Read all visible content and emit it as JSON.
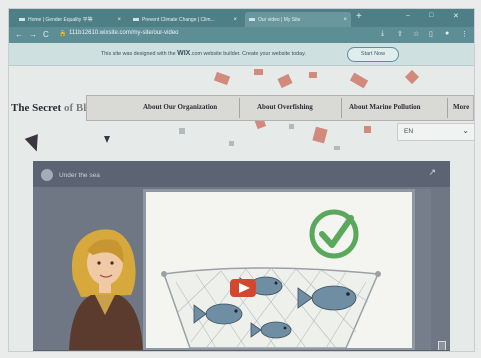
{
  "browser": {
    "tabs": [
      {
        "label": "Home | Gender Equality 平等",
        "active": false
      },
      {
        "label": "Prevent Climate Change | Clim...",
        "active": false
      },
      {
        "label": "Our video | My Site",
        "active": true
      }
    ],
    "new_tab_symbol": "+",
    "window_controls": {
      "minimize": "–",
      "maximize": "□",
      "close": "✕"
    },
    "nav": {
      "back": "←",
      "forward": "→",
      "reload": "C"
    },
    "url": "111b12610.wixsite.com/my-site/our-video",
    "address_icons": [
      "download-icon",
      "share-icon",
      "star-icon",
      "sidebar-icon",
      "profile-icon",
      "kebab-icon"
    ]
  },
  "wix_banner": {
    "text_prefix": "This site was designed with the ",
    "brand": "WIX",
    "text_suffix": ".com website builder. Create your website today.",
    "button_label": "Start Now"
  },
  "site": {
    "title_part1": "The Secret ",
    "title_part2": "of Black Rock",
    "menu": [
      "About Our Organization",
      "About Overfishing",
      "About Marine Pollution",
      "More"
    ],
    "language": {
      "code": "EN",
      "chevron": "⌄"
    }
  },
  "video": {
    "title": "Under the sea",
    "share_symbol": "↗",
    "illustration": {
      "check_color": "#59a85c",
      "net_color": "#9aa0a5",
      "fish_color": "#6f8ea3",
      "play_button_color": "#d1482f"
    }
  }
}
